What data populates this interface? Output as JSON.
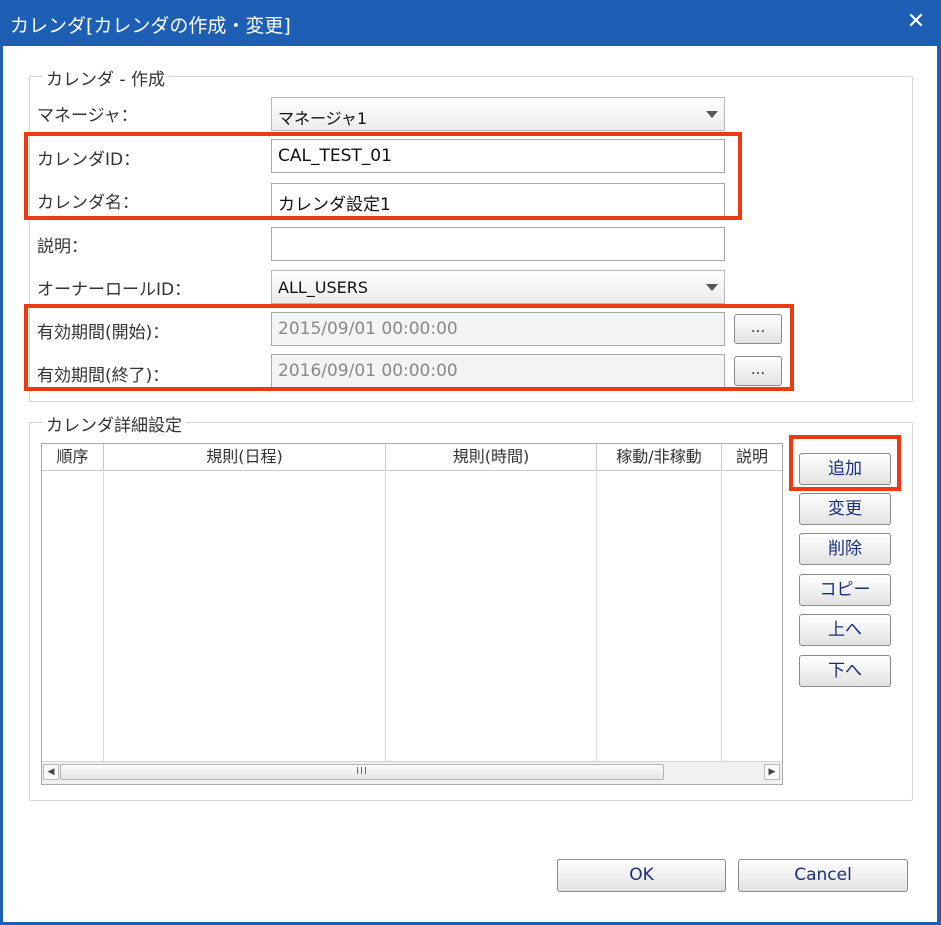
{
  "window": {
    "title": "カレンダ[カレンダの作成・変更]",
    "close_label": "✕"
  },
  "calendar_section": {
    "legend": "カレンダ - 作成",
    "manager_label": "マネージャ：",
    "manager_value": "マネージャ1",
    "calendar_id_label": "カレンダID：",
    "calendar_id_value": "CAL_TEST_01",
    "calendar_name_label": "カレンダ名：",
    "calendar_name_value": "カレンダ設定1",
    "description_label": "説明：",
    "description_value": "",
    "owner_role_label": "オーナーロールID：",
    "owner_role_value": "ALL_USERS",
    "valid_start_label": "有効期間(開始)：",
    "valid_start_value": "2015/09/01 00:00:00",
    "valid_end_label": "有効期間(終了)：",
    "valid_end_value": "2016/09/01 00:00:00",
    "picker_label": "..."
  },
  "detail_section": {
    "legend": "カレンダ詳細設定",
    "columns": [
      "順序",
      "規則(日程)",
      "規則(時間)",
      "稼動/非稼動",
      "説明"
    ],
    "scroll_thumb_grip": "III",
    "buttons": {
      "add": "追加",
      "modify": "変更",
      "delete": "削除",
      "copy": "コピー",
      "up": "上へ",
      "down": "下へ"
    }
  },
  "footer": {
    "ok_label": "OK",
    "cancel_label": "Cancel"
  },
  "colors": {
    "titlebar": "#1d5fb5",
    "highlight": "#ee3a12",
    "button_text": "#1a2f7a"
  }
}
